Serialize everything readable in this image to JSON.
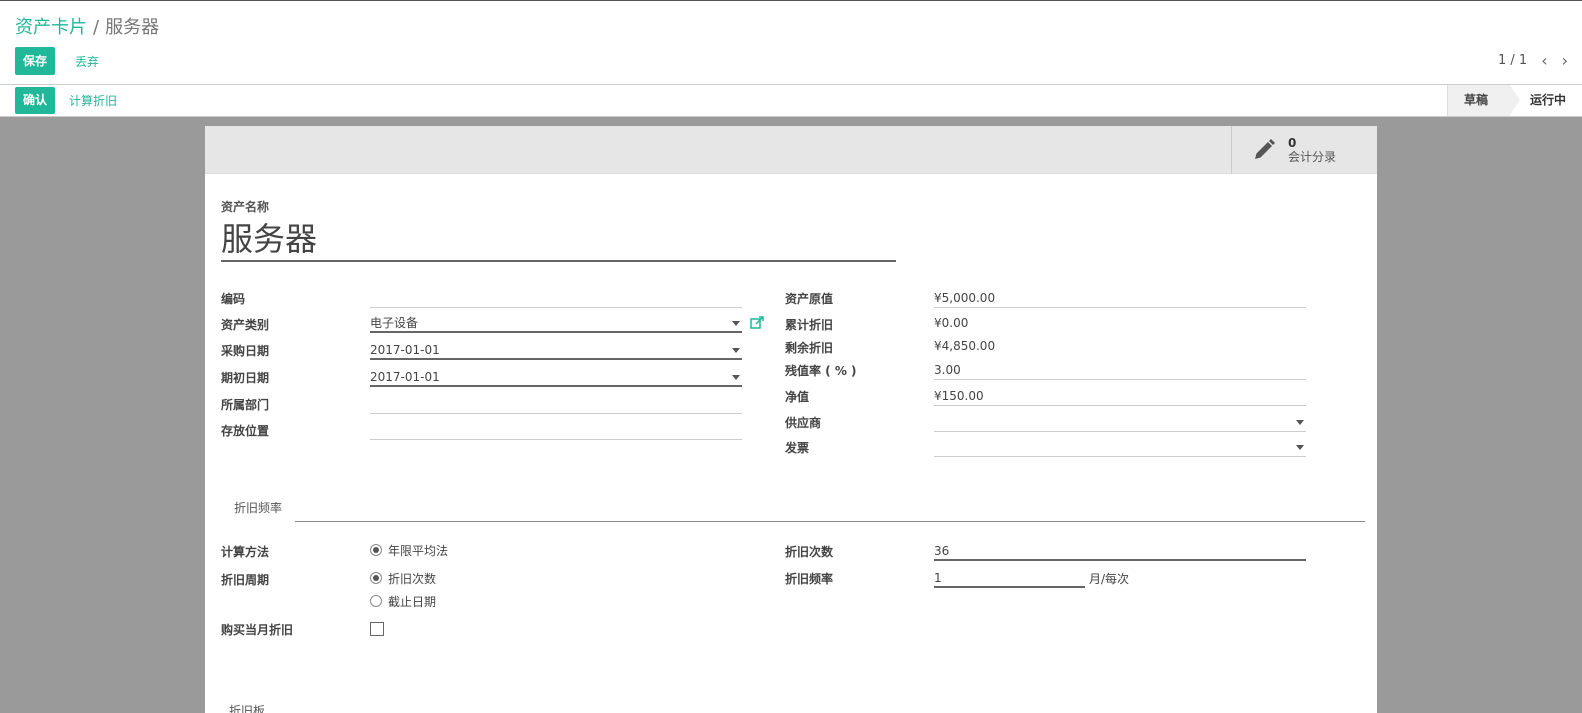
{
  "breadcrumb": {
    "parent": "资产卡片",
    "separator": "/",
    "current": "服务器"
  },
  "toolbar": {
    "save_label": "保存",
    "discard_label": "丢弃"
  },
  "pager": {
    "value": "1 / 1",
    "prev_icon": "chevron-left-icon",
    "next_icon": "chevron-right-icon"
  },
  "statusbar": {
    "confirm_label": "确认",
    "compute_label": "计算折旧",
    "stages": [
      "草稿",
      "运行中"
    ]
  },
  "stat_button": {
    "count": "0",
    "label": "会计分录",
    "icon": "pencil-icon"
  },
  "form": {
    "name_label": "资产名称",
    "name_value": "服务器",
    "left": {
      "code_label": "编码",
      "code_value": "",
      "category_label": "资产类别",
      "category_value": "电子设备",
      "purchase_date_label": "采购日期",
      "purchase_date_value": "2017-01-01",
      "first_date_label": "期初日期",
      "first_date_value": "2017-01-01",
      "department_label": "所属部门",
      "department_value": "",
      "location_label": "存放位置",
      "location_value": ""
    },
    "right": {
      "gross_label": "资产原值",
      "gross_value": "¥5,000.00",
      "accum_label": "累计折旧",
      "accum_value": "¥0.00",
      "residual_label": "剩余折旧",
      "residual_value": "¥4,850.00",
      "salvage_rate_label": "残值率 ( % )",
      "salvage_rate_value": "3.00",
      "net_label": "净值",
      "net_value": "¥150.00",
      "vendor_label": "供应商",
      "vendor_value": "",
      "invoice_label": "发票",
      "invoice_value": ""
    }
  },
  "tabs": {
    "active": "折旧频率",
    "next_cut": "折旧板"
  },
  "depreciation": {
    "method_label": "计算方法",
    "method_option": "年限平均法",
    "period_label": "折旧周期",
    "period_option_count": "折旧次数",
    "period_option_date": "截止日期",
    "first_month_label": "购买当月折旧",
    "count_label": "折旧次数",
    "count_value": "36",
    "freq_label": "折旧频率",
    "freq_value": "1",
    "freq_unit": "月/每次"
  },
  "colors": {
    "accent": "#21b799",
    "background": "#9a9a9a"
  }
}
